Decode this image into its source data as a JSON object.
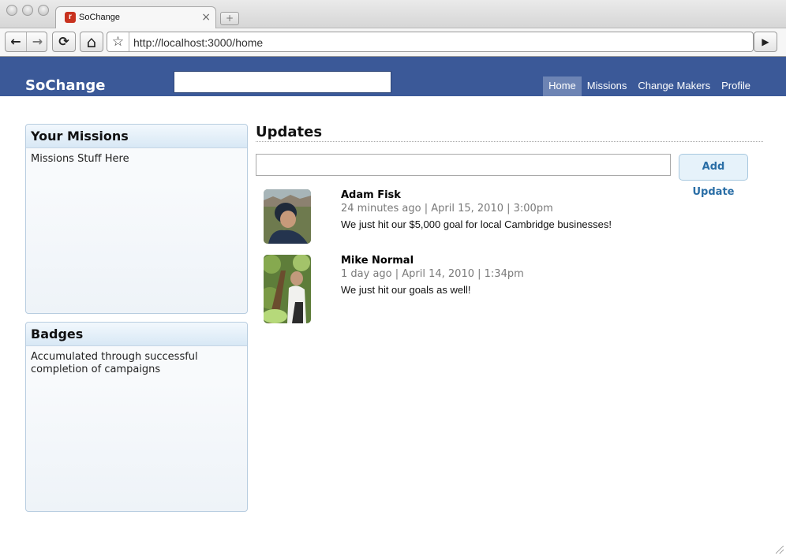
{
  "browser": {
    "tab_title": "SoChange",
    "favicon_letter": "r",
    "url": "http://localhost:3000/home",
    "buttons": {
      "back": "←",
      "forward": "→",
      "reload": "⟳",
      "home": "⌂",
      "bookmark": "☆",
      "go": "▶",
      "close_tab": "×",
      "new_tab": "+"
    }
  },
  "header": {
    "brand": "SoChange",
    "search_value": "",
    "nav": [
      {
        "label": "Home",
        "active": true
      },
      {
        "label": "Missions",
        "active": false
      },
      {
        "label": "Change Makers",
        "active": false
      },
      {
        "label": "Profile",
        "active": false
      }
    ]
  },
  "sidebar": {
    "missions": {
      "title": "Your Missions",
      "body": "Missions Stuff Here"
    },
    "badges": {
      "title": "Badges",
      "body": "Accumulated through successful completion of campaigns"
    }
  },
  "updates": {
    "title": "Updates",
    "input_value": "",
    "add_button": "Add Update",
    "items": [
      {
        "name": "Adam Fisk",
        "meta": "24 minutes ago | April 15, 2010 | 3:00pm",
        "text": "We just hit our $5,000 goal for local Cambridge businesses!",
        "avatar": "avatar-photo"
      },
      {
        "name": "Mike Normal",
        "meta": "1 day ago | April 14, 2010 | 1:34pm",
        "text": "We just hit our goals as well!",
        "avatar": "avatar-photo"
      }
    ]
  }
}
